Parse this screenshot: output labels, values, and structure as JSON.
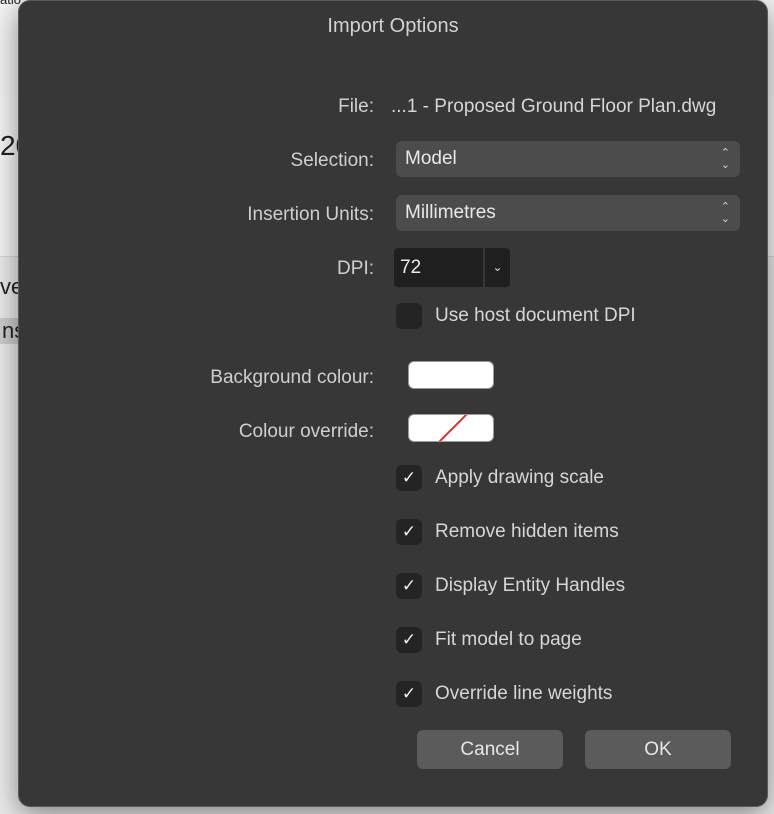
{
  "background": {
    "fragment_top": "atio",
    "fragment_mid": "20",
    "fragment_row1": "ve",
    "fragment_row2": "ns"
  },
  "dialog": {
    "title": "Import Options",
    "file": {
      "label": "File:",
      "value": "...1 - Proposed Ground Floor Plan.dwg"
    },
    "selection": {
      "label": "Selection:",
      "value": "Model"
    },
    "insertion_units": {
      "label": "Insertion Units:",
      "value": "Millimetres"
    },
    "dpi": {
      "label": "DPI:",
      "value": "72"
    },
    "use_host_dpi": {
      "label": "Use host document DPI",
      "checked": false
    },
    "background_colour": {
      "label": "Background colour:",
      "color": "#ffffff"
    },
    "colour_override": {
      "label": "Colour override:",
      "state": "none"
    },
    "options": [
      {
        "label": "Apply drawing scale",
        "checked": true
      },
      {
        "label": "Remove hidden items",
        "checked": true
      },
      {
        "label": "Display Entity Handles",
        "checked": true
      },
      {
        "label": "Fit model to page",
        "checked": true
      },
      {
        "label": "Override line weights",
        "checked": true
      }
    ],
    "buttons": {
      "cancel": "Cancel",
      "ok": "OK"
    }
  },
  "icons": {
    "popup_arrows": "updown-chevron-icon",
    "combo_arrow": "chevron-down-icon",
    "checkmark": "checkmark-icon"
  },
  "colors": {
    "dialog_bg": "#373737",
    "control_bg": "#4c4c4c",
    "swatch_slash": "#e0312b"
  }
}
